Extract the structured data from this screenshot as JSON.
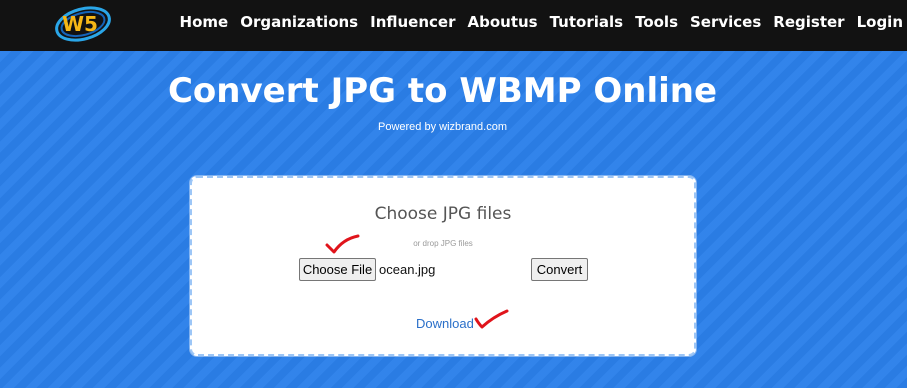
{
  "navbar": {
    "logo_text": "W5",
    "links": [
      "Home",
      "Organizations",
      "Influencer",
      "Aboutus",
      "Tutorials",
      "Tools",
      "Services",
      "Register",
      "Login"
    ]
  },
  "hero": {
    "title": "Convert JPG to WBMP Online",
    "powered_by": "Powered by wizbrand.com"
  },
  "converter": {
    "choose_title": "Choose JPG files",
    "drop_hint": "or drop JPG files",
    "choose_file_label": "Choose File",
    "file_name": "ocean.jpg",
    "convert_label": "Convert",
    "download_label": "Download"
  },
  "colors": {
    "background": "#2b80ea",
    "navbar": "#121212",
    "annotation": "#e0141b",
    "link": "#2a6fc9"
  }
}
